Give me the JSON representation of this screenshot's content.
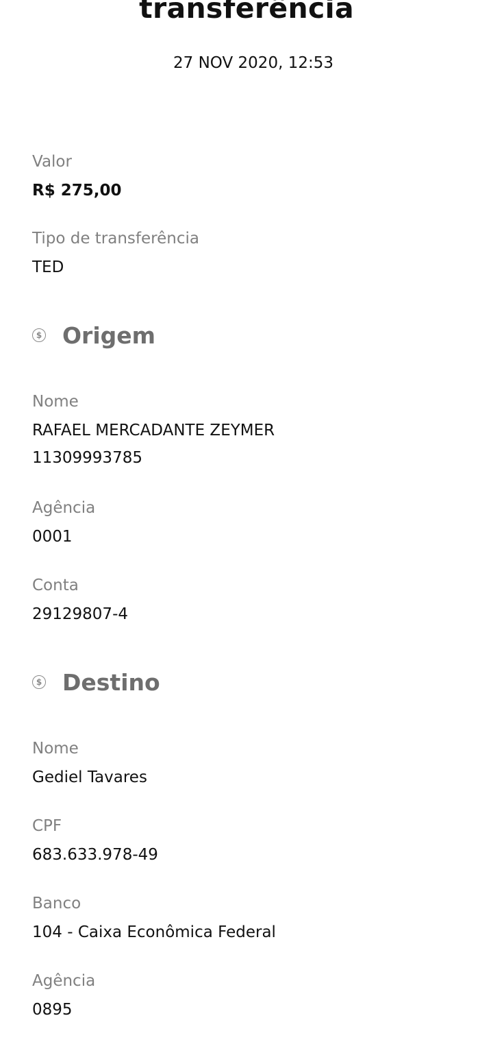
{
  "header": {
    "title": "transferência",
    "datetime": "27 NOV 2020, 12:53"
  },
  "summary": {
    "amount_label": "Valor",
    "amount_value": "R$ 275,00",
    "type_label": "Tipo de transferência",
    "type_value": "TED"
  },
  "origin": {
    "section_icon": "dollar-coin-icon",
    "section_icon_glyph": "$",
    "section_title": "Origem",
    "name_label": "Nome",
    "name_value": "RAFAEL MERCADANTE ZEYMER",
    "document_value": "11309993785",
    "agency_label": "Agência",
    "agency_value": "0001",
    "account_label": "Conta",
    "account_value": "29129807-4"
  },
  "destination": {
    "section_icon": "dollar-coin-icon",
    "section_icon_glyph": "$",
    "section_title": "Destino",
    "name_label": "Nome",
    "name_value": "Gediel Tavares",
    "cpf_label": "CPF",
    "cpf_value": "683.633.978-49",
    "bank_label": "Banco",
    "bank_value": "104 - Caixa Econômica Federal",
    "agency_label": "Agência",
    "agency_value": "0895"
  },
  "colors": {
    "text": "#111111",
    "label": "#808080",
    "section": "#6e6e6e",
    "background": "#ffffff"
  }
}
